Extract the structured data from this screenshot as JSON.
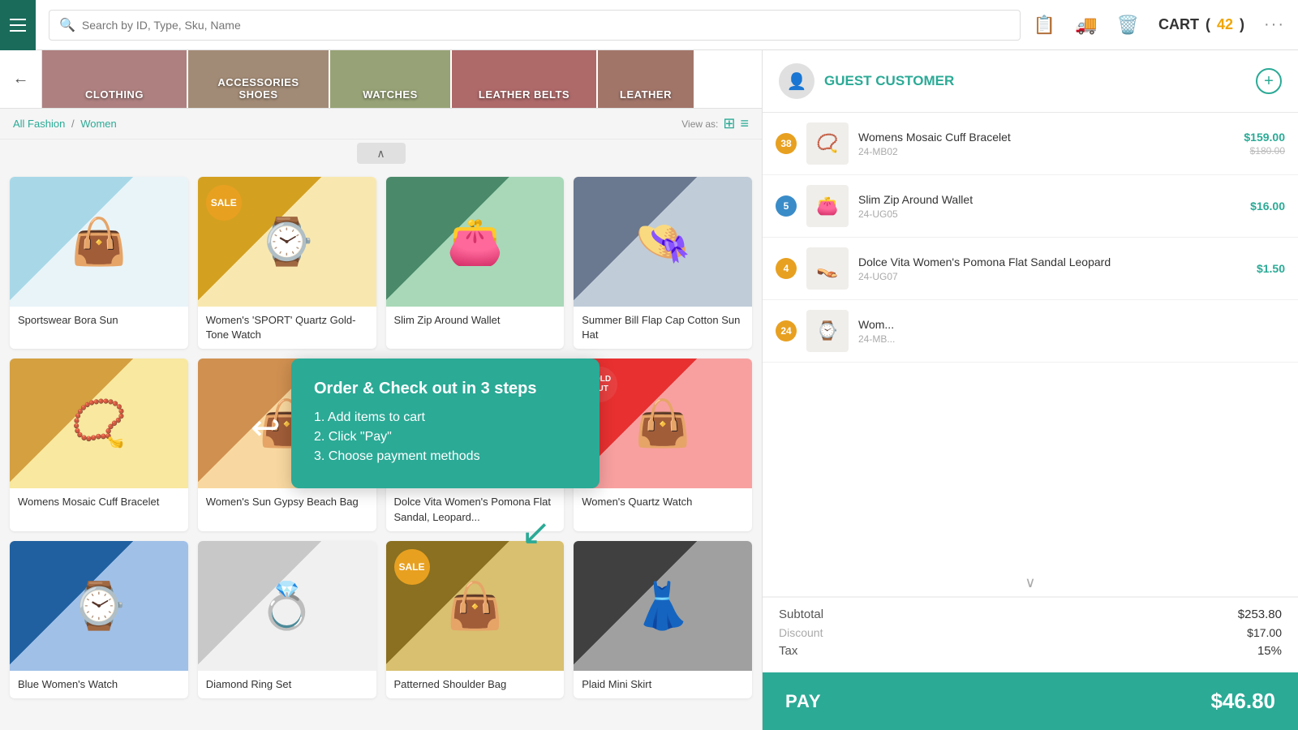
{
  "header": {
    "search_placeholder": "Search by ID, Type, Sku, Name",
    "cart_label": "CART",
    "cart_count": "42",
    "menu_icon": "☰"
  },
  "categories": [
    {
      "id": "clothing",
      "label": "CLOTHING",
      "color": "#8b4a4a"
    },
    {
      "id": "accessories",
      "label": "ACCESSORIES\nSHOES",
      "color": "#7a5a3c"
    },
    {
      "id": "watches",
      "label": "WATCHES",
      "color": "#6b7a3c"
    },
    {
      "id": "leather-belts",
      "label": "LEATHER BELTS",
      "color": "#8b2a2a"
    },
    {
      "id": "leather2",
      "label": "LEATHER",
      "color": "#7a3a2a"
    }
  ],
  "breadcrumb": {
    "parent": "All Fashion",
    "current": "Women"
  },
  "view_as": "View as:",
  "products": [
    {
      "id": 1,
      "name": "Sportswear Bora Sun",
      "badge": null,
      "badge_type": null,
      "img_class": "img-bag",
      "emoji": "👜"
    },
    {
      "id": 2,
      "name": "Women's 'SPORT' Quartz Gold-Tone Watch",
      "badge": "SALE",
      "badge_type": "sale",
      "img_class": "img-watch",
      "emoji": "⌚"
    },
    {
      "id": 3,
      "name": "Slim Zip Around Wallet",
      "badge": null,
      "badge_type": null,
      "img_class": "img-wallet",
      "emoji": "👛"
    },
    {
      "id": 4,
      "name": "Summer Bill Flap Cap Cotton Sun Hat",
      "badge": null,
      "badge_type": null,
      "img_class": "img-hat",
      "emoji": "👒"
    },
    {
      "id": 5,
      "name": "Womens Mosaic Cuff Bracelet",
      "badge": null,
      "badge_type": null,
      "img_class": "img-bracelet",
      "emoji": "💛"
    },
    {
      "id": 6,
      "name": "Women's Sun Gypsy Beach Bag",
      "badge": null,
      "badge_type": null,
      "img_class": "img-beach-bag",
      "emoji": "👜"
    },
    {
      "id": 7,
      "name": "Dolce Vita Women's Pomona Flat Sandal, Leopard...",
      "badge": null,
      "badge_type": null,
      "img_class": "img-sandal",
      "emoji": "👡"
    },
    {
      "id": 8,
      "name": "Women's Quartz Watch",
      "badge": "SOLD OUT",
      "badge_type": "soldout",
      "img_class": "img-round-bag",
      "emoji": "👜"
    },
    {
      "id": 9,
      "name": "Blue Women's Watch",
      "badge": null,
      "badge_type": null,
      "img_class": "img-watch2",
      "emoji": "⌚"
    },
    {
      "id": 10,
      "name": "Diamond Ring Set",
      "badge": null,
      "badge_type": null,
      "img_class": "img-ring",
      "emoji": "💍"
    },
    {
      "id": 11,
      "name": "Patterned Shoulder Bag",
      "badge": "SALE",
      "badge_type": "sale",
      "img_class": "img-handbag",
      "emoji": "👜"
    },
    {
      "id": 12,
      "name": "Plaid Mini Skirt",
      "badge": null,
      "badge_type": null,
      "img_class": "img-skirt",
      "emoji": "👗"
    }
  ],
  "customer": {
    "name": "GUEST CUSTOMER",
    "avatar_icon": "👤"
  },
  "cart_items": [
    {
      "id": 1,
      "qty": 38,
      "qty_color": "orange",
      "name": "Womens Mosaic Cuff Bracelet",
      "sku": "24-MB02",
      "price": "$159.00",
      "original_price": "$180.00",
      "emoji": "💛"
    },
    {
      "id": 2,
      "qty": 5,
      "qty_color": "blue",
      "name": "Slim Zip Around Wallet",
      "sku": "24-UG05",
      "price": "$16.00",
      "original_price": null,
      "emoji": "👛"
    },
    {
      "id": 3,
      "qty": 4,
      "qty_color": "orange",
      "name": "Dolce Vita Women's Pomona Flat Sandal Leopard",
      "sku": "24-UG07",
      "price": "$1.50",
      "original_price": null,
      "emoji": "👡"
    },
    {
      "id": 4,
      "qty": 24,
      "qty_color": "orange",
      "name": "Wom...",
      "sku": "24-MB...",
      "price": "",
      "original_price": null,
      "emoji": "⌚"
    }
  ],
  "summary": {
    "subtotal_label": "Subtotal",
    "subtotal_value": "$253.80",
    "discount_label": "Discount",
    "discount_value": "$17.00",
    "tax_label": "Tax",
    "tax_value": "15%"
  },
  "pay": {
    "label": "PAY",
    "amount": "$46.80"
  },
  "tooltip": {
    "title": "Order & Check out in 3 steps",
    "steps": [
      "1. Add items to cart",
      "2. Click \"Pay\"",
      "3. Choose payment methods"
    ]
  }
}
